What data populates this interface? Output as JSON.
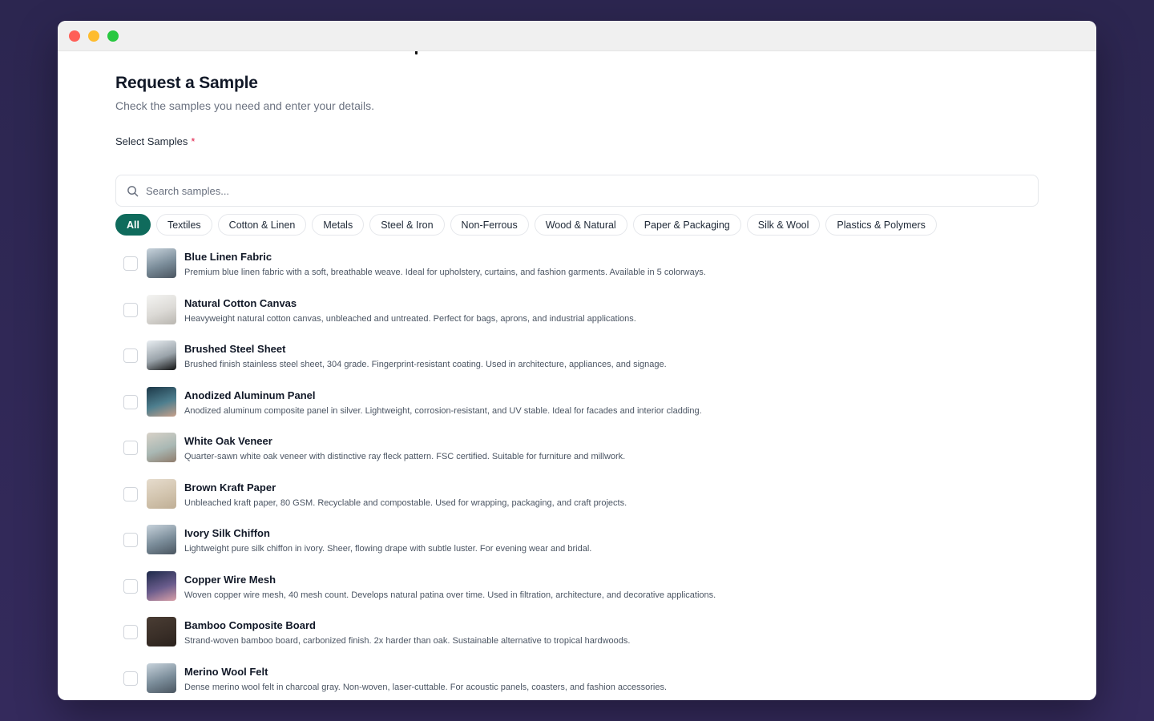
{
  "window": {
    "controls": [
      {
        "name": "close-button",
        "color": "#ff5f57"
      },
      {
        "name": "minimize-button",
        "color": "#febc2e"
      },
      {
        "name": "maximize-button",
        "color": "#28c840"
      }
    ]
  },
  "page": {
    "title": "Request a Sample",
    "subtitle": "Check the samples you need and enter your details.",
    "field_label": "Select Samples",
    "required_mark": "*"
  },
  "search": {
    "placeholder": "Search samples...",
    "icon": "search-icon"
  },
  "filters": [
    {
      "label": "All",
      "active": true
    },
    {
      "label": "Textiles",
      "active": false
    },
    {
      "label": "Cotton & Linen",
      "active": false
    },
    {
      "label": "Metals",
      "active": false
    },
    {
      "label": "Steel & Iron",
      "active": false
    },
    {
      "label": "Non-Ferrous",
      "active": false
    },
    {
      "label": "Wood & Natural",
      "active": false
    },
    {
      "label": "Paper & Packaging",
      "active": false
    },
    {
      "label": "Silk & Wool",
      "active": false
    },
    {
      "label": "Plastics & Polymers",
      "active": false
    }
  ],
  "samples": [
    {
      "name": "Blue Linen Fabric",
      "description": "Premium blue linen fabric with a soft, breathable weave. Ideal for upholstery, curtains, and fashion garments. Available in 5 colorways.",
      "checked": false,
      "thumb_colors": [
        "#c8d3dc",
        "#7a8c99",
        "#4a5560"
      ]
    },
    {
      "name": "Natural Cotton Canvas",
      "description": "Heavyweight natural cotton canvas, unbleached and untreated. Perfect for bags, aprons, and industrial applications.",
      "checked": false,
      "thumb_colors": [
        "#f4f4f2",
        "#dcdad6",
        "#b9b6b0"
      ]
    },
    {
      "name": "Brushed Steel Sheet",
      "description": "Brushed finish stainless steel sheet, 304 grade. Fingerprint-resistant coating. Used in architecture, appliances, and signage.",
      "checked": false,
      "thumb_colors": [
        "#e9eef2",
        "#9aa3aa",
        "#111111"
      ]
    },
    {
      "name": "Anodized Aluminum Panel",
      "description": "Anodized aluminum composite panel in silver. Lightweight, corrosion-resistant, and UV stable. Ideal for facades and interior cladding.",
      "checked": false,
      "thumb_colors": [
        "#1c3848",
        "#4e7f8f",
        "#c9a08a"
      ]
    },
    {
      "name": "White Oak Veneer",
      "description": "Quarter-sawn white oak veneer with distinctive ray fleck pattern. FSC certified. Suitable for furniture and millwork.",
      "checked": false,
      "thumb_colors": [
        "#d8d2c8",
        "#a9b8b4",
        "#8f7c6c"
      ]
    },
    {
      "name": "Brown Kraft Paper",
      "description": "Unbleached kraft paper, 80 GSM. Recyclable and compostable. Used for wrapping, packaging, and craft projects.",
      "checked": false,
      "thumb_colors": [
        "#e6dccd",
        "#d2c4ae",
        "#bfae95"
      ]
    },
    {
      "name": "Ivory Silk Chiffon",
      "description": "Lightweight pure silk chiffon in ivory. Sheer, flowing drape with subtle luster. For evening wear and bridal.",
      "checked": false,
      "thumb_colors": [
        "#c8d3dc",
        "#7a8c99",
        "#4a5560"
      ]
    },
    {
      "name": "Copper Wire Mesh",
      "description": "Woven copper wire mesh, 40 mesh count. Develops natural patina over time. Used in filtration, architecture, and decorative applications.",
      "checked": false,
      "thumb_colors": [
        "#1e2a4a",
        "#6a5c8c",
        "#d9a0a8"
      ]
    },
    {
      "name": "Bamboo Composite Board",
      "description": "Strand-woven bamboo board, carbonized finish. 2x harder than oak. Sustainable alternative to tropical hardwoods.",
      "checked": false,
      "thumb_colors": [
        "#4a3d34",
        "#3a2f28",
        "#2b221d"
      ]
    },
    {
      "name": "Merino Wool Felt",
      "description": "Dense merino wool felt in charcoal gray. Non-woven, laser-cuttable. For acoustic panels, coasters, and fashion accessories.",
      "checked": false,
      "thumb_colors": [
        "#c8d3dc",
        "#7a8c99",
        "#4a5560"
      ]
    }
  ],
  "colors": {
    "accent": "#0f6b5c",
    "required": "#e11d48"
  }
}
